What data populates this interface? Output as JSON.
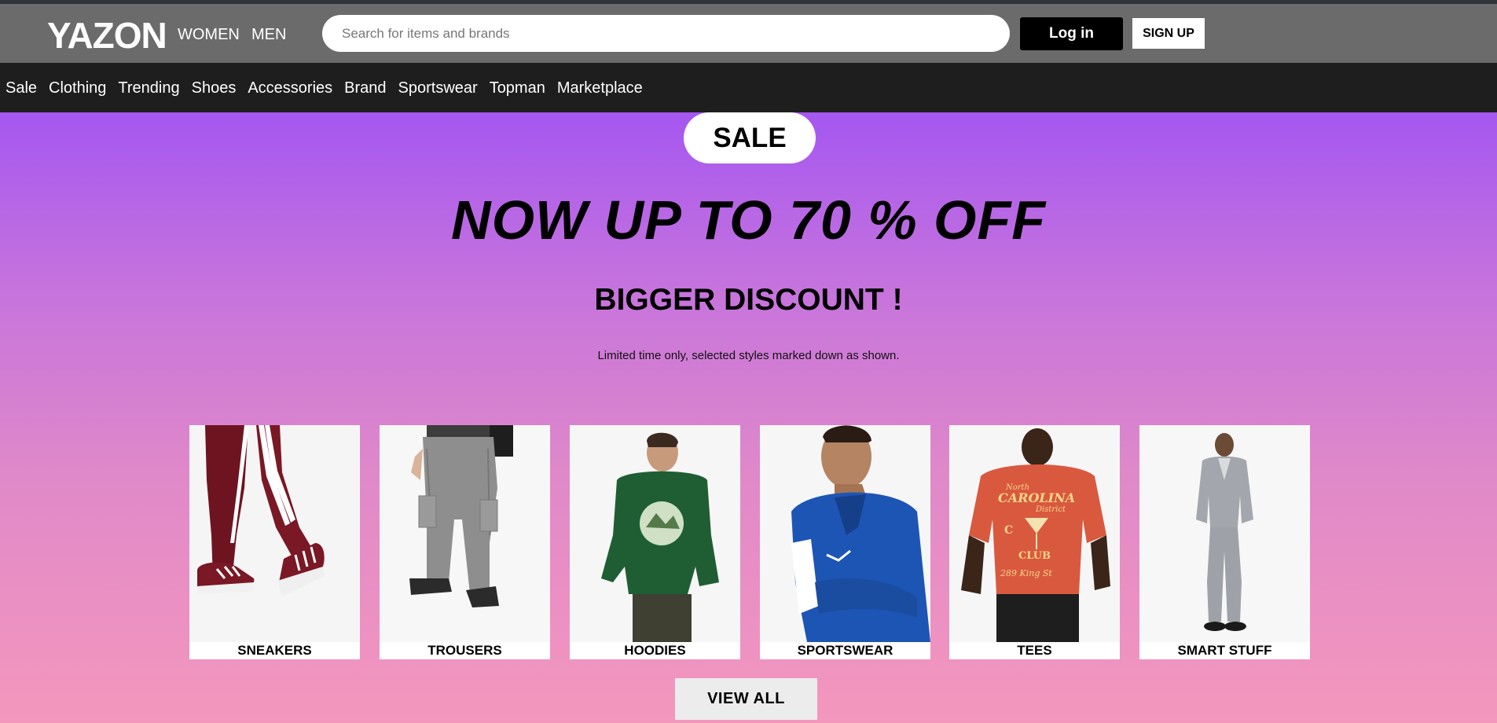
{
  "header": {
    "logo": "YAZON",
    "nav_women": "WOMEN",
    "nav_men": "MEN",
    "search_placeholder": "Search for items and brands",
    "login_label": "Log in",
    "signup_label": "SIGN UP"
  },
  "categories": [
    "Sale",
    "Clothing",
    "Trending",
    "Shoes",
    "Accessories",
    "Brand",
    "Sportswear",
    "Topman",
    "Marketplace"
  ],
  "hero": {
    "badge": "SALE",
    "headline": "NOW UP TO 70 % OFF",
    "subheadline": "BIGGER DISCOUNT !",
    "note": "Limited time only, selected styles marked down as shown.",
    "gradient_top": "#a557f0",
    "gradient_bottom": "#f497bd"
  },
  "tiles": [
    {
      "label": "SNEAKERS",
      "icon": "sneakers-photo"
    },
    {
      "label": "TROUSERS",
      "icon": "trousers-photo"
    },
    {
      "label": "HOODIES",
      "icon": "hoodie-photo"
    },
    {
      "label": "SPORTSWEAR",
      "icon": "sportswear-photo"
    },
    {
      "label": "TEES",
      "icon": "tee-photo"
    },
    {
      "label": "SMART STUFF",
      "icon": "suit-photo"
    }
  ],
  "tee_print": {
    "line1": "North",
    "line2": "CAROLINA",
    "line3": "District",
    "line4": "C",
    "line5": "CLUB",
    "line6": "289 King St"
  },
  "view_all_label": "VIEW ALL"
}
